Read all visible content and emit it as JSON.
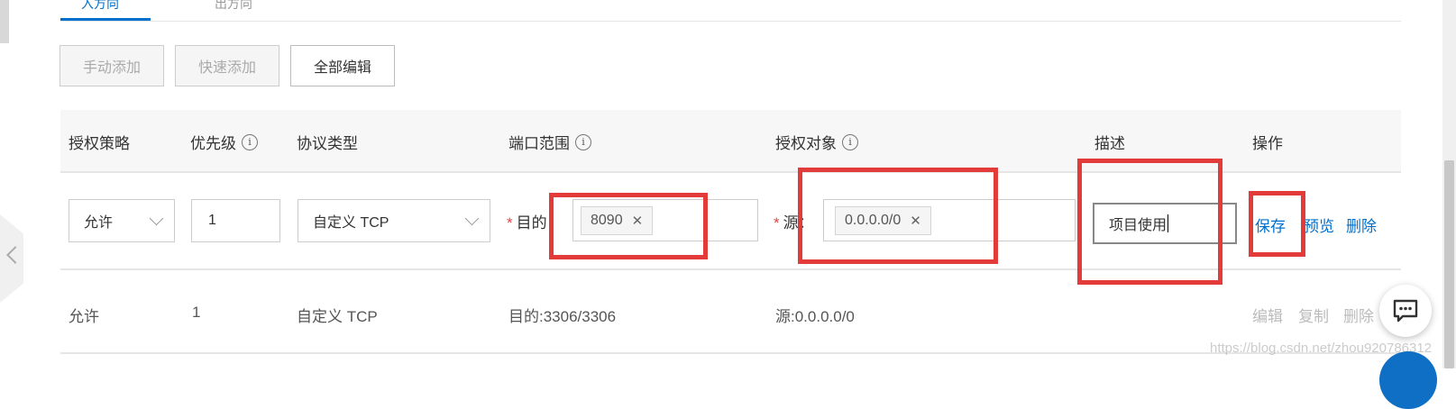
{
  "tabs": {
    "inbound_fragment": "入方向",
    "outbound_fragment": "出方向"
  },
  "toolbar": {
    "manual_add": "手动添加",
    "quick_add": "快速添加",
    "edit_all": "全部编辑"
  },
  "table": {
    "headers": {
      "policy": "授权策略",
      "priority": "优先级",
      "protocol": "协议类型",
      "port_range": "端口范围",
      "auth_object": "授权对象",
      "description": "描述",
      "actions": "操作"
    },
    "info_glyph": "i",
    "edit_row": {
      "policy": "允许",
      "priority": "1",
      "protocol": "自定义 TCP",
      "port_label": "目的：",
      "port_tag": "8090",
      "source_label": "源：",
      "source_tag": "0.0.0.0/0",
      "description": "项目使用",
      "save": "保存",
      "preview": "预览",
      "delete": "删除"
    },
    "rows": [
      {
        "policy": "允许",
        "priority": "1",
        "protocol": "自定义 TCP",
        "port_range": "目的:3306/3306",
        "auth_object": "源:0.0.0.0/0",
        "edit": "编辑",
        "copy": "复制",
        "delete": "删除"
      }
    ]
  },
  "watermark": "https://blog.csdn.net/zhou920786312",
  "colors": {
    "accent": "#0070cc",
    "highlight_box": "#e33a3a",
    "required_star": "#e54545"
  },
  "icons": [
    "info-icon",
    "chevron-down-icon",
    "close-icon",
    "chat-icon",
    "chevron-left-icon"
  ]
}
